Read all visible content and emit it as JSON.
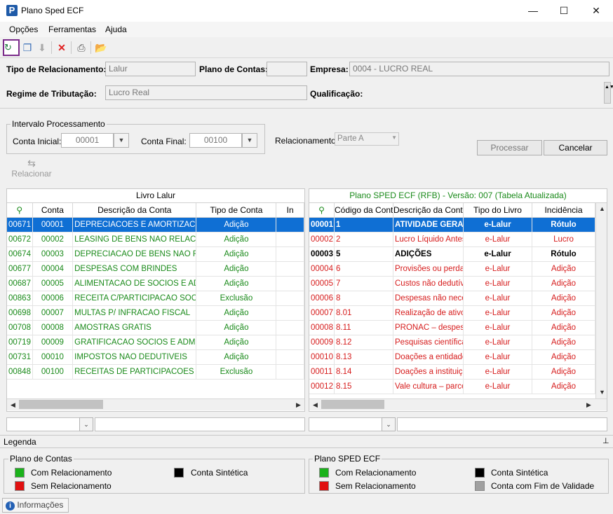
{
  "window": {
    "title": "Plano Sped ECF",
    "app_icon_letter": "P",
    "minimize": "—",
    "maximize": "☐",
    "close": "✕"
  },
  "menu": [
    "Opções",
    "Ferramentas",
    "Ajuda"
  ],
  "toolbar": {
    "icons": [
      "new-icon",
      "copy-icon",
      "thumb-icon",
      "delete-icon",
      "print-icon",
      "folder-icon"
    ]
  },
  "header": {
    "tipo_rel_label": "Tipo de Relacionamento:",
    "tipo_rel_value": "Lalur",
    "plano_label": "Plano de Contas:",
    "plano_value": "",
    "empresa_label": "Empresa:",
    "empresa_value": "0004 - LUCRO REAL",
    "regime_label": "Regime de Tributação:",
    "regime_value": "Lucro Real",
    "qualificacao_label": "Qualificação:"
  },
  "intervalo": {
    "title": "Intervalo Processamento",
    "conta_inicial_label": "Conta Inicial:",
    "conta_inicial_value": "00001",
    "conta_final_label": "Conta Final:",
    "conta_final_value": "00100"
  },
  "relacionamento": {
    "label": "Relacionamento:",
    "value": "Parte A"
  },
  "buttons": {
    "processar": "Processar",
    "cancelar": "Cancelar",
    "relacionar": "Relacionar"
  },
  "left_grid": {
    "title": "Livro Lalur",
    "columns": [
      "",
      "Conta",
      "Descrição da Conta",
      "Tipo de Conta",
      "In"
    ],
    "rows": [
      {
        "id": "00671",
        "conta": "00001",
        "desc": "DEPRECIACOES E AMORTIZACOES ESPEC",
        "tipo": "Adição",
        "sel": true
      },
      {
        "id": "00672",
        "conta": "00002",
        "desc": "LEASING DE BENS NAO RELACIONADOS",
        "tipo": "Adição"
      },
      {
        "id": "00674",
        "conta": "00003",
        "desc": "DEPRECIACAO DE BENS NAO RELACIONA",
        "tipo": "Adição"
      },
      {
        "id": "00677",
        "conta": "00004",
        "desc": "DESPESAS COM BRINDES",
        "tipo": "Adição"
      },
      {
        "id": "00687",
        "conta": "00005",
        "desc": "ALIMENTACAO DE SOCIOS E ADMINISTR",
        "tipo": "Adição"
      },
      {
        "id": "00863",
        "conta": "00006",
        "desc": "RECEITA C/PARTICIPACAO SOCIETARIA",
        "tipo": "Exclusão"
      },
      {
        "id": "00698",
        "conta": "00007",
        "desc": "MULTAS P/ INFRACAO FISCAL",
        "tipo": "Adição"
      },
      {
        "id": "00708",
        "conta": "00008",
        "desc": "AMOSTRAS GRATIS",
        "tipo": "Adição"
      },
      {
        "id": "00719",
        "conta": "00009",
        "desc": "GRATIFICACAO SOCIOS E ADMINISTRAD",
        "tipo": "Adição"
      },
      {
        "id": "00731",
        "conta": "00010",
        "desc": "IMPOSTOS NAO DEDUTIVEIS",
        "tipo": "Adição"
      },
      {
        "id": "00848",
        "conta": "00100",
        "desc": "RECEITAS DE PARTICIPACOES SOCIETA",
        "tipo": "Exclusão"
      }
    ]
  },
  "right_grid": {
    "title": "Plano SPED ECF (RFB) - Versão: 007 (Tabela Atualizada)",
    "columns": [
      "",
      "Código da Conta",
      "Descrição da Conta",
      "Tipo do Livro",
      "Incidência"
    ],
    "rows": [
      {
        "id": "00001",
        "codigo": "1",
        "desc": "ATIVIDADE GERAL",
        "livro": "e-Lalur",
        "inc": "Rótulo",
        "style": "black",
        "sel": true
      },
      {
        "id": "00002",
        "codigo": "2",
        "desc": "Lucro Líquido Antes do IRPJ",
        "livro": "e-Lalur",
        "inc": "Lucro",
        "style": "red"
      },
      {
        "id": "00003",
        "codigo": "5",
        "desc": "ADIÇÕES",
        "livro": "e-Lalur",
        "inc": "Rótulo",
        "style": "black"
      },
      {
        "id": "00004",
        "codigo": "6",
        "desc": "Provisões ou perdas",
        "livro": "e-Lalur",
        "inc": "Adição",
        "style": "red"
      },
      {
        "id": "00005",
        "codigo": "7",
        "desc": "Custos não dedutíveis",
        "livro": "e-Lalur",
        "inc": "Adição",
        "style": "red"
      },
      {
        "id": "00006",
        "codigo": "8",
        "desc": "Despesas não necessárias",
        "livro": "e-Lalur",
        "inc": "Adição",
        "style": "red"
      },
      {
        "id": "00007",
        "codigo": "8.01",
        "desc": "Realização de ativos",
        "livro": "e-Lalur",
        "inc": "Adição",
        "style": "red"
      },
      {
        "id": "00008",
        "codigo": "8.11",
        "desc": "PRONAC – despesas",
        "livro": "e-Lalur",
        "inc": "Adição",
        "style": "red"
      },
      {
        "id": "00009",
        "codigo": "8.12",
        "desc": "Pesquisas científicas",
        "livro": "e-Lalur",
        "inc": "Adição",
        "style": "red"
      },
      {
        "id": "00010",
        "codigo": "8.13",
        "desc": "Doações a entidades",
        "livro": "e-Lalur",
        "inc": "Adição",
        "style": "red"
      },
      {
        "id": "00011",
        "codigo": "8.14",
        "desc": "Doações a instituições",
        "livro": "e-Lalur",
        "inc": "Adição",
        "style": "red"
      },
      {
        "id": "00012",
        "codigo": "8.15",
        "desc": "Vale cultura – parcela",
        "livro": "e-Lalur",
        "inc": "Adição",
        "style": "red"
      }
    ]
  },
  "legenda": {
    "title": "Legenda",
    "plano_contas": {
      "title": "Plano de Contas",
      "com": "Com Relacionamento",
      "sem": "Sem Relacionamento",
      "sintetica": "Conta Sintética"
    },
    "plano_sped": {
      "title": "Plano SPED ECF",
      "com": "Com Relacionamento",
      "sem": "Sem Relacionamento",
      "sintetica": "Conta Sintética",
      "fim_validade": "Conta com Fim de Validade"
    },
    "colors": {
      "green": "#1bb21b",
      "red": "#e01010",
      "black": "#000000",
      "gray": "#a0a0a0"
    }
  },
  "status_tab": "Informações"
}
